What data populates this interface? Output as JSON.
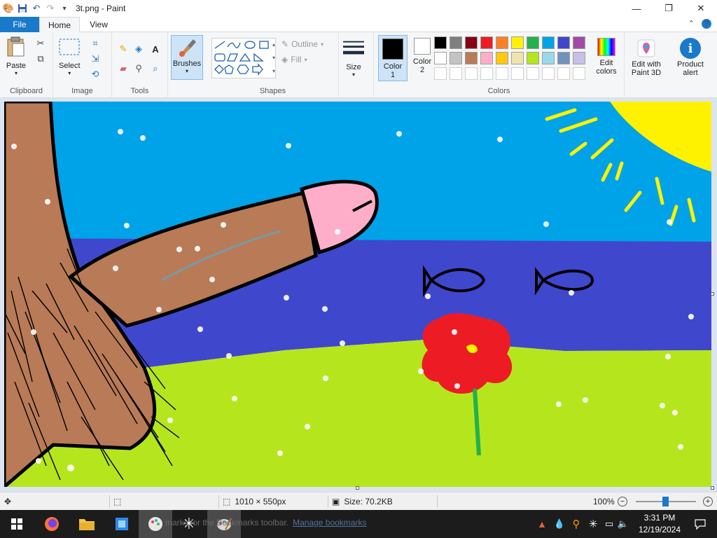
{
  "window": {
    "title": "3t.png - Paint",
    "minimize_glyph": "—",
    "maximize_glyph": "❐",
    "close_glyph": "✕"
  },
  "menu": {
    "tabs": [
      {
        "label": "File"
      },
      {
        "label": "Home"
      },
      {
        "label": "View"
      }
    ],
    "collapse_glyph": "⌃",
    "help_glyph": "?"
  },
  "ribbon": {
    "clipboard": {
      "label": "Clipboard",
      "paste": "Paste"
    },
    "image": {
      "label": "Image",
      "select": "Select"
    },
    "tools": {
      "label": "Tools"
    },
    "brushes": {
      "label": "Brushes"
    },
    "shapes": {
      "label": "Shapes",
      "outline": "Outline",
      "fill": "Fill"
    },
    "size": {
      "label": "Size"
    },
    "colors": {
      "label": "Colors",
      "color1": "Color 1",
      "color2": "Color 2",
      "edit": "Edit colors",
      "color1_value": "#000000",
      "color2_value": "#ffffff",
      "palette": [
        "#000000",
        "#7f7f7f",
        "#880015",
        "#ed1c24",
        "#ff7f27",
        "#fff200",
        "#22b14c",
        "#00a2e8",
        "#3f48cc",
        "#a349a4",
        "#ffffff",
        "#c3c3c3",
        "#b97a57",
        "#ffaec9",
        "#ffc90e",
        "#efe4b0",
        "#b5e61d",
        "#99d9ea",
        "#7092be",
        "#c8bfe7",
        "#ffffff",
        "#ffffff",
        "#ffffff",
        "#ffffff",
        "#ffffff",
        "#ffffff",
        "#ffffff",
        "#ffffff",
        "#ffffff",
        "#ffffff"
      ]
    },
    "paint3d": {
      "label": "Edit with Paint 3D"
    },
    "alert": {
      "label": "Product alert"
    }
  },
  "painting": {
    "colors": {
      "sky": "#00a2e8",
      "sea": "#3f48cc",
      "grass": "#b5e61d",
      "sun": "#fff200",
      "skin": "#b97a57",
      "tip": "#ffaec9",
      "flower": "#ed1c24",
      "stem": "#22b14c",
      "outline": "#000000"
    }
  },
  "status": {
    "dimensions": "1010 × 550px",
    "size": "Size: 70.2KB",
    "zoom": "100%",
    "zoom_out": "−",
    "zoom_in": "+"
  },
  "taskbar": {
    "ghost_text": "marks for the Bookmarks toolbar.",
    "ghost_link": "Manage bookmarks",
    "time": "3:31 PM",
    "date": "12/19/2024"
  }
}
